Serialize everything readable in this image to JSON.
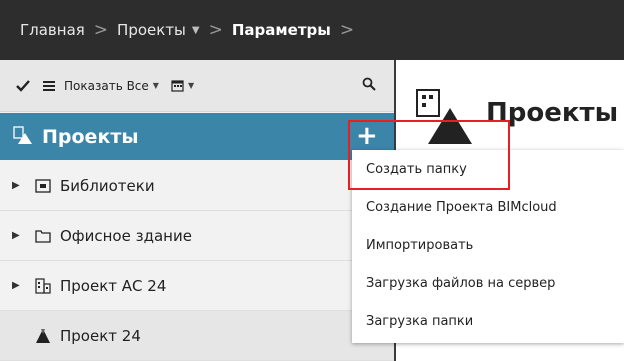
{
  "breadcrumb": {
    "items": [
      "Главная",
      "Проекты",
      "Параметры"
    ],
    "separator": ">"
  },
  "toolbar": {
    "show_all_label": "Показать Все"
  },
  "panel": {
    "title": "Проекты"
  },
  "tree": {
    "items": [
      {
        "label": "Библиотеки",
        "icon": "library-folder-icon"
      },
      {
        "label": "Офисное здание",
        "icon": "folder-icon"
      },
      {
        "label": "Проект АС 24",
        "icon": "building-icon"
      },
      {
        "label": "Проект 24",
        "icon": "project-icon"
      }
    ]
  },
  "right": {
    "title": "Проекты"
  },
  "menu": {
    "items": [
      "Создать папку",
      "Создание Проекта BIMcloud",
      "Импортировать",
      "Загрузка файлов на сервер",
      "Загрузка папки"
    ]
  },
  "colors": {
    "topbar": "#2d2d2d",
    "header": "#3b86a8",
    "highlight": "#e62020"
  }
}
